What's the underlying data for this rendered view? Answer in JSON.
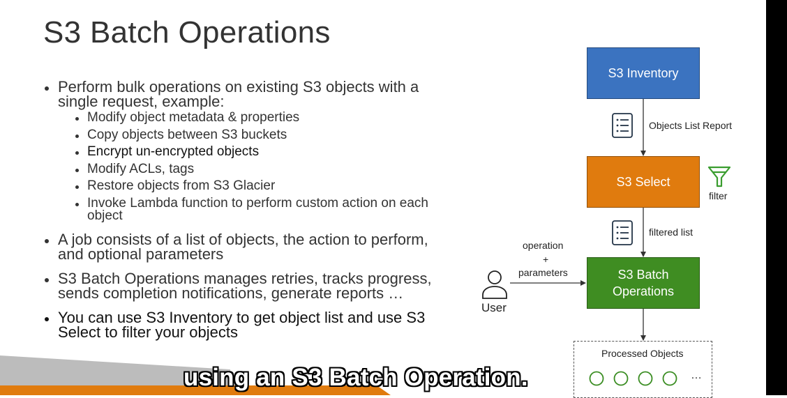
{
  "slide": {
    "title": "S3 Batch Operations",
    "bullets": [
      {
        "text": "Perform bulk operations on existing S3 objects with a single request, example:",
        "children": [
          "Modify object metadata & properties",
          "Copy objects between S3 buckets",
          "Encrypt un-encrypted objects",
          "Modify ACLs, tags",
          "Restore objects from S3 Glacier",
          "Invoke Lambda function to perform custom action on each object"
        ]
      },
      {
        "text": "A job consists of a list of objects, the action to perform, and optional parameters"
      },
      {
        "text": "S3 Batch Operations manages retries, tracks progress, sends completion notifications, generate reports …"
      },
      {
        "text": "You can use S3 Inventory to get object list and use S3 Select to filter your objects"
      }
    ]
  },
  "diagram": {
    "s3_inventory": "S3 Inventory",
    "objects_list_report": "Objects List Report",
    "s3_select": "S3 Select",
    "filter": "filter",
    "filtered_list": "filtered list",
    "s3_batch_line1": "S3 Batch",
    "s3_batch_line2": "Operations",
    "operation": "operation",
    "plus": "+",
    "parameters": "parameters",
    "user": "User",
    "processed_objects": "Processed Objects",
    "ellipsis": "…",
    "colors": {
      "inventory": "#3b73c0",
      "select": "#e07b0e",
      "batch": "#3f8d22",
      "filter_icon": "#3a9d2f",
      "doc_icon": "#233447"
    }
  },
  "subtitle": {
    "text": "using an S3 Batch Operation."
  },
  "decor": {
    "orange_stripe": "#e07b0e",
    "gray_stripe": "#bcbcbc"
  }
}
